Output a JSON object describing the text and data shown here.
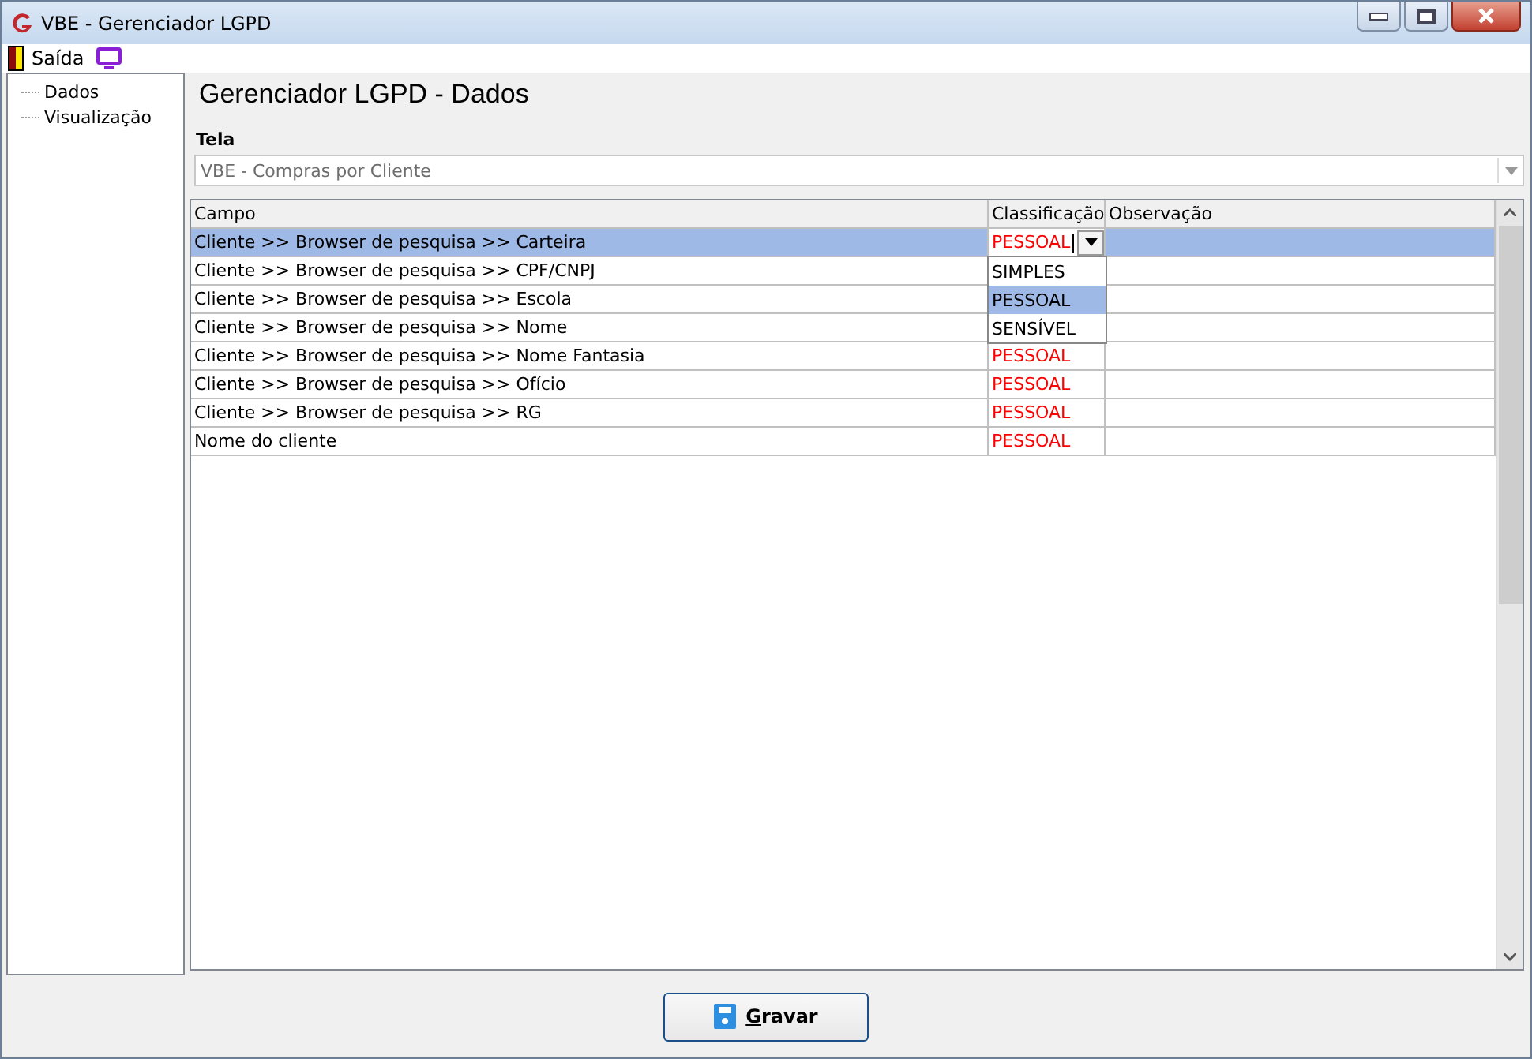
{
  "window": {
    "title": "VBE - Gerenciador LGPD"
  },
  "menu": [
    {
      "label": "Saída"
    }
  ],
  "tree": [
    {
      "label": "Dados"
    },
    {
      "label": "Visualização"
    }
  ],
  "heading": "Gerenciador LGPD - Dados",
  "screen_field": {
    "label": "Tela",
    "value": "VBE - Compras por Cliente"
  },
  "table": {
    "columns": [
      "Campo",
      "Classificação",
      "Observação"
    ],
    "rows": [
      {
        "campo": "Cliente >> Browser de pesquisa >> Carteira",
        "classificacao": "PESSOAL",
        "selected": true,
        "editing": true
      },
      {
        "campo": "Cliente >> Browser de pesquisa >> CPF/CNPJ",
        "selected": false,
        "editing": false
      },
      {
        "campo": "Cliente >> Browser de pesquisa >> Escola",
        "selected": false,
        "editing": false
      },
      {
        "campo": "Cliente >> Browser de pesquisa >> Nome",
        "selected": false,
        "editing": false
      },
      {
        "campo": "Cliente >> Browser de pesquisa >> Nome Fantasia",
        "classificacao": "PESSOAL",
        "selected": false,
        "editing": false
      },
      {
        "campo": "Cliente >> Browser de pesquisa >> Ofício",
        "classificacao": "PESSOAL",
        "selected": false,
        "editing": false
      },
      {
        "campo": "Cliente >> Browser de pesquisa >> RG",
        "classificacao": "PESSOAL",
        "selected": false,
        "editing": false
      },
      {
        "campo": "Nome do cliente",
        "classificacao": "PESSOAL",
        "selected": false,
        "editing": false
      }
    ],
    "dropdown_options": [
      {
        "label": "SIMPLES",
        "selected": false
      },
      {
        "label": "PESSOAL",
        "selected": true
      },
      {
        "label": "SENSÍVEL",
        "selected": false
      }
    ]
  },
  "save_button": {
    "label": "Gravar"
  }
}
